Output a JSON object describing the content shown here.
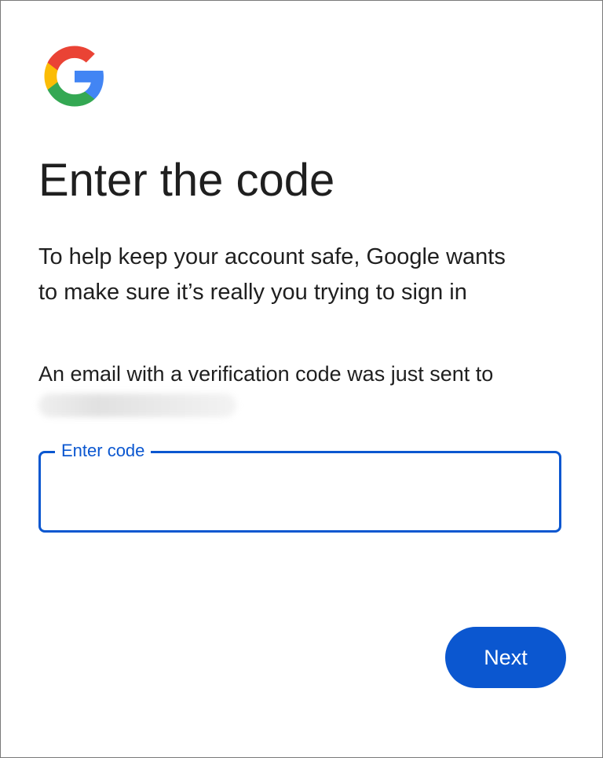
{
  "brand": {
    "logo": "google-g-logo",
    "colors": {
      "blue": "#4285F4",
      "red": "#EA4335",
      "yellow": "#FBBC05",
      "green": "#34A853"
    }
  },
  "header": {
    "title": "Enter the code"
  },
  "intro": {
    "line1": "To help keep your account safe, Google wants",
    "line2": "to make sure it’s really you trying to sign in"
  },
  "verification": {
    "sent_text": "An email with a verification code was just sent to"
  },
  "code_input": {
    "label": "Enter code",
    "value": ""
  },
  "actions": {
    "next_label": "Next",
    "accent_color": "#0b57d0"
  }
}
